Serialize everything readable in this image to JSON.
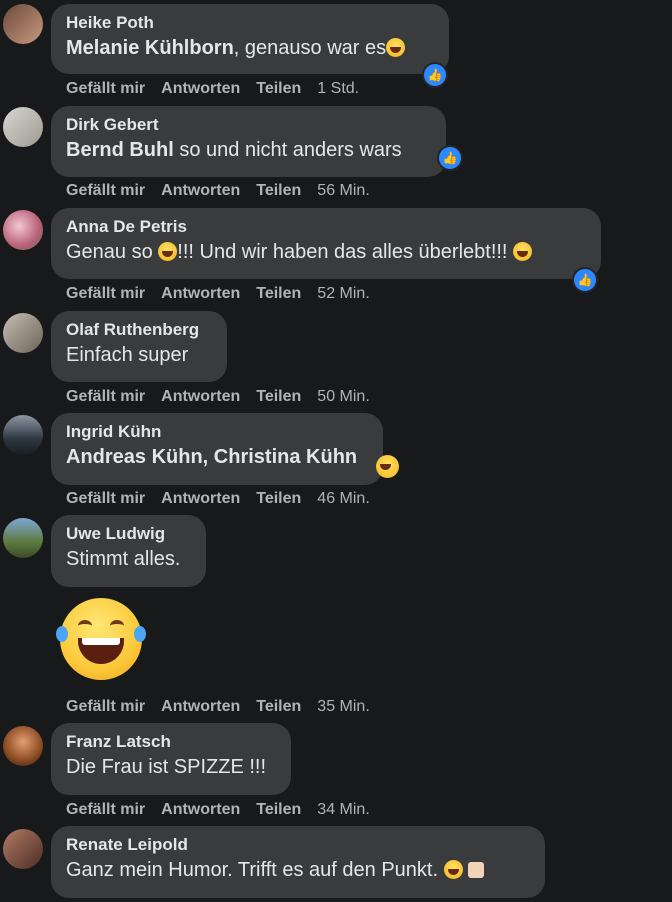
{
  "actions": {
    "like": "Gefällt mir",
    "reply": "Antworten",
    "share": "Teilen"
  },
  "comments": [
    {
      "author": "Heike Poth",
      "mention": "Melanie Kühlborn",
      "text": ", genauso war es",
      "time": "1 Std."
    },
    {
      "author": "Dirk Gebert",
      "mention": "Bernd Buhl",
      "text": " so und nicht anders wars",
      "time": "56 Min."
    },
    {
      "author": "Anna De Petris",
      "text_a": "Genau so ",
      "text_b": "!!! Und wir haben das alles überlebt!!! ",
      "time": "52 Min."
    },
    {
      "author": "Olaf Ruthenberg",
      "text": "Einfach super",
      "time": "50 Min."
    },
    {
      "author": "Ingrid Kühn",
      "mention": "Andreas Kühn, Christina Kühn",
      "time": "46 Min."
    },
    {
      "author": "Uwe Ludwig",
      "text": "Stimmt alles.",
      "time": "35 Min."
    },
    {
      "author": "Franz Latsch",
      "text": "Die Frau ist SPIZZE !!!",
      "time": "34 Min."
    },
    {
      "author": "Renate Leipold",
      "text": "Ganz mein Humor. Trifft es auf den Punkt. ",
      "time": ""
    }
  ],
  "colors": {
    "background": "#18191a",
    "bubble": "#3a3b3c",
    "text": "#e4e6eb",
    "meta": "#b0b3b8",
    "like_blue": "#2d88ff"
  },
  "icons": {
    "like_badge": "thumbs-up-icon",
    "emoji": "tears-of-joy-emoji",
    "sticker": "laughing-sticker"
  }
}
